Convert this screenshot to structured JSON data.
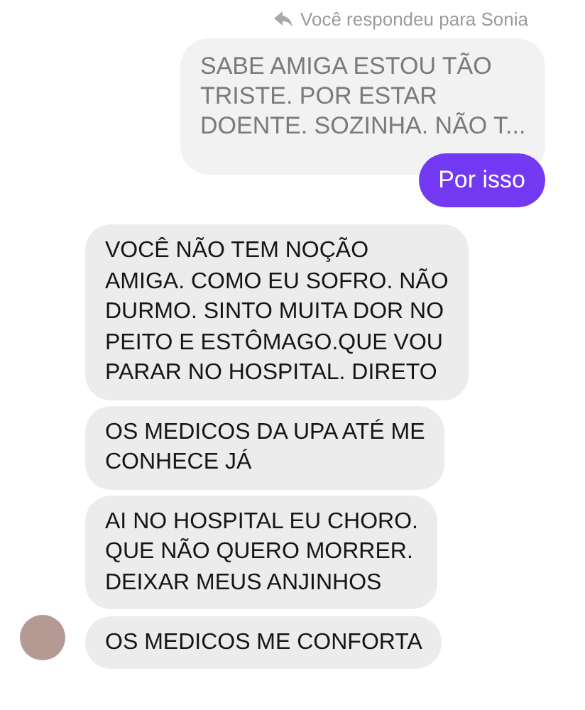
{
  "reply_note": {
    "text": "Você respondeu para Sonia"
  },
  "quoted_message": {
    "text": "SABE AMIGA ESTOU TÃO\nTRISTE. POR ESTAR\nDOENTE. SOZINHA. NÃO T..."
  },
  "sent_message": {
    "text": "Por isso"
  },
  "received_messages": [
    {
      "text": "VOCÊ NÃO TEM NOÇÃO\nAMIGA. COMO EU SOFRO. NÃO\nDURMO. SINTO MUITA DOR NO\nPEITO E ESTÔMAGO.QUE VOU\nPARAR NO HOSPITAL. DIRETO",
      "avatar": false
    },
    {
      "text": "OS MEDICOS DA UPA ATÉ ME\nCONHECE JÁ",
      "avatar": false
    },
    {
      "text": "AI NO HOSPITAL EU CHORO.\nQUE NÃO QUERO MORRER.\nDEIXAR MEUS ANJINHOS",
      "avatar": false
    },
    {
      "text": "OS MEDICOS ME CONFORTA",
      "avatar": true
    }
  ]
}
